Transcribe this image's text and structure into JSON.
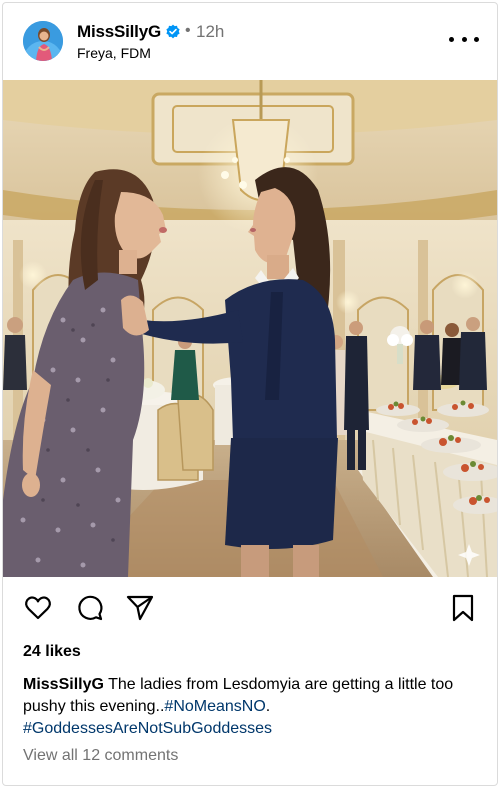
{
  "post": {
    "username": "MissSillyG",
    "verified": true,
    "separator": "•",
    "time": "12h",
    "location": "Freya, FDM",
    "more_icon": "more-horizontal-icon"
  },
  "actions": {
    "like_icon": "heart-icon",
    "comment_icon": "comment-icon",
    "share_icon": "send-icon",
    "save_icon": "bookmark-icon"
  },
  "likes": "24 likes",
  "caption": {
    "username": "MissSillyG",
    "text": " The ladies from Lesdomyia are getting a little too pushy this evening..",
    "hashtag1": "#NoMeansNO",
    "text2": ". ",
    "hashtag2": "#GoddessesAreNotSubGoddesses"
  },
  "comments_link": "View all 12 comments",
  "colors": {
    "hashtag": "#00376b",
    "secondary_text": "#737373",
    "verified_badge": "#0095f6",
    "border": "#dbdbdb"
  }
}
